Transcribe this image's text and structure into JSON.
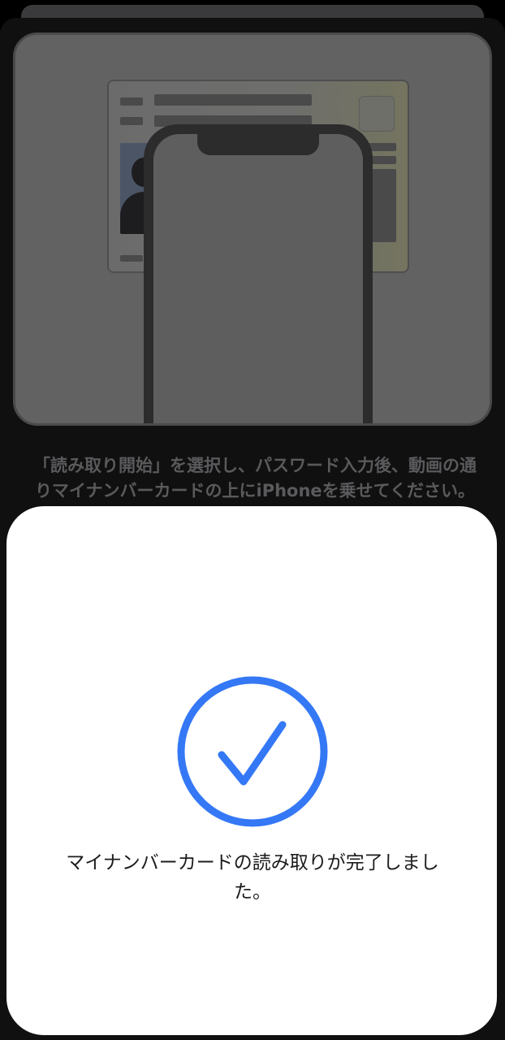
{
  "background": {
    "instruction_text": "「読み取り開始」を選択し、パスワード入力後、動画の通りマイナンバーカードの上にiPhoneを乗せてください。"
  },
  "completion_sheet": {
    "message": "マイナンバーカードの読み取りが完了しました。",
    "icon": "checkmark-circle-icon",
    "accent_color": "#3478f6"
  }
}
